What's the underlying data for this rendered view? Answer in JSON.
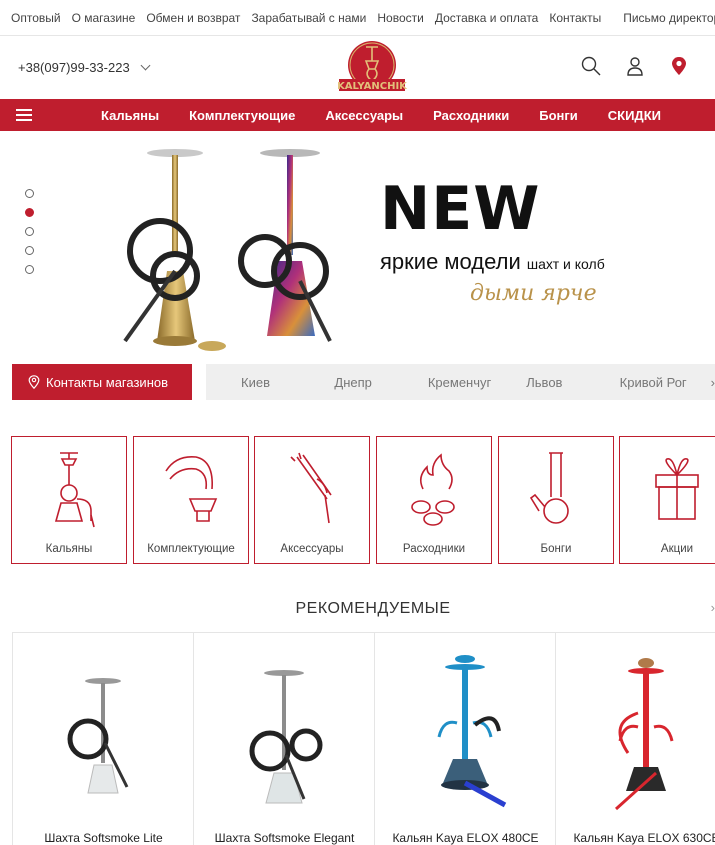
{
  "topnav": {
    "links": [
      "Оптовый",
      "О магазине",
      "Обмен и возврат",
      "Зарабатывай с нами",
      "Новости",
      "Доставка и оплата",
      "Контакты"
    ],
    "right_link": "Письмо директору"
  },
  "header": {
    "phone": "+38(097)99-33-223",
    "logo_text": "KALYANCHIK",
    "icons": [
      "search-icon",
      "user-icon",
      "location-pin-icon"
    ]
  },
  "mainnav": {
    "items": [
      "Кальяны",
      "Комплектующие",
      "Аксессуары",
      "Расходники",
      "Бонги",
      "СКИДКИ"
    ]
  },
  "hero": {
    "title": "NEW",
    "subtitle": "яркие модели",
    "subtitle_small": "шахт и колб",
    "script": "дыми ярче",
    "slides_count": 5,
    "active_slide": 2
  },
  "stores": {
    "button_label": "Контакты магазинов",
    "cities": [
      "Киев",
      "Днепр",
      "Кременчуг",
      "Львов",
      "Кривой Рог"
    ]
  },
  "categories": [
    {
      "label": "Кальяны",
      "icon": "hookah-icon"
    },
    {
      "label": "Комплектующие",
      "icon": "bowl-icon"
    },
    {
      "label": "Аксессуары",
      "icon": "tongs-icon"
    },
    {
      "label": "Расходники",
      "icon": "coals-icon"
    },
    {
      "label": "Бонги",
      "icon": "bong-icon"
    },
    {
      "label": "Акции",
      "icon": "gift-icon"
    }
  ],
  "recommended": {
    "title": "РЕКОМЕНДУЕМЫЕ",
    "products": [
      {
        "name": "Шахта Softsmoke Lite",
        "color": "#9aa0a6"
      },
      {
        "name": "Шахта Softsmoke Elegant",
        "color": "#9aa0a6"
      },
      {
        "name": "Кальян Kaya ELOX 480CE",
        "color": "#1f8fc7"
      },
      {
        "name": "Кальян Kaya ELOX 630CE",
        "color": "#d8262e"
      }
    ]
  },
  "colors": {
    "accent": "#bf1e2e",
    "gold": "#b9924a"
  }
}
